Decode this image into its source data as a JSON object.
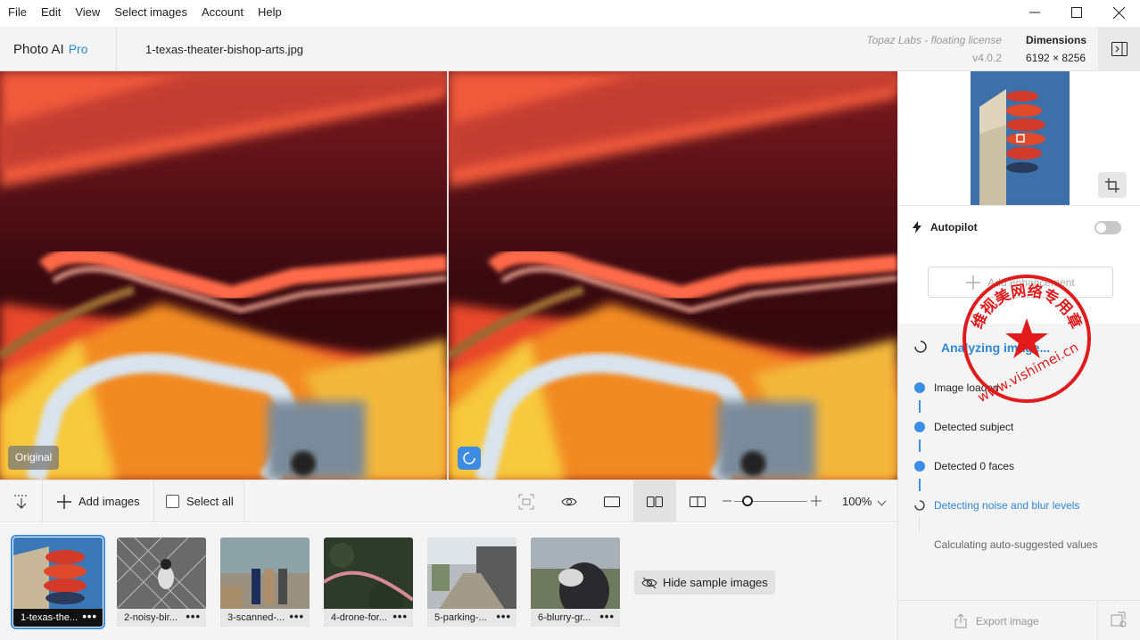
{
  "menu": [
    "File",
    "Edit",
    "View",
    "Select images",
    "Account",
    "Help"
  ],
  "header": {
    "app_name": "Photo AI",
    "app_tier": "Pro",
    "filename": "1-texas-theater-bishop-arts.jpg",
    "license": "Topaz Labs - floating license",
    "version": "v4.0.2",
    "dimensions_label": "Dimensions",
    "dimensions_value": "6192 × 8256"
  },
  "viewer": {
    "original_badge": "Original"
  },
  "toolbar": {
    "add_images": "Add images",
    "select_all": "Select all",
    "zoom": "100%",
    "zoom_slider_fraction": 0.18
  },
  "filmstrip": {
    "thumbnails": [
      {
        "label": "1-texas-the...",
        "selected": true
      },
      {
        "label": "2-noisy-bir...",
        "selected": false
      },
      {
        "label": "3-scanned-...",
        "selected": false
      },
      {
        "label": "4-drone-for...",
        "selected": false
      },
      {
        "label": "5-parking-...",
        "selected": false
      },
      {
        "label": "6-blurry-gr...",
        "selected": false
      }
    ],
    "more_glyph": "•••",
    "hide_samples": "Hide sample images"
  },
  "panel": {
    "autopilot": "Autopilot",
    "add_enhancement": "Add enhancement",
    "analyzing": "Analyzing image...",
    "steps": [
      {
        "label": "Image loaded",
        "state": "done"
      },
      {
        "label": "Detected subject",
        "state": "done"
      },
      {
        "label": "Detected 0 faces",
        "state": "done"
      },
      {
        "label": "Detecting noise and blur levels",
        "state": "active"
      },
      {
        "label": "Calculating auto-suggested values",
        "state": "pending"
      }
    ],
    "export": "Export image"
  },
  "stamp": {
    "text": "维视美网络专用章",
    "url": "www.vishimei.cn"
  },
  "colors": {
    "accent": "#2f87d8",
    "stamp_red": "#e11b1b"
  }
}
